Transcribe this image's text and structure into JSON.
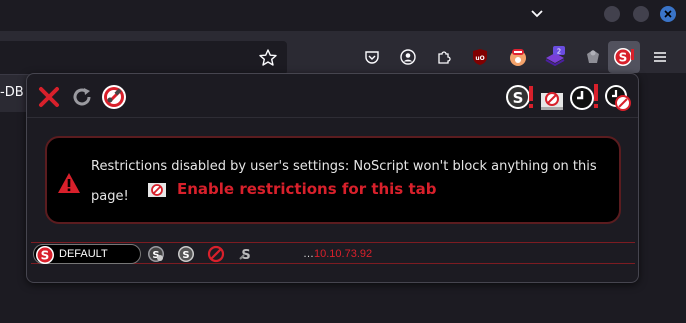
{
  "browser": {
    "tab_partial_label": "-DB",
    "toolbar_icons": [
      "star-icon",
      "pocket-icon",
      "account-icon",
      "extensions-icon",
      "ublock-icon",
      "extension-icon",
      "extension-badge-icon",
      "extension-icon",
      "noscript-icon",
      "menu-icon"
    ],
    "badge_count": "2"
  },
  "popup": {
    "header_icons": [
      "close-icon",
      "reload-icon",
      "options-icon",
      "global-disable-icon",
      "revoke-temp-icon",
      "temp-trust-all-icon",
      "temp-trust-page-icon"
    ],
    "warning": {
      "message": "Restrictions disabled by user's settings: NoScript won't block anything on this page!",
      "enable_label": "Enable restrictions for this tab"
    },
    "preset_row": {
      "preset": "DEFAULT",
      "dots": "…",
      "host": "10.10.73.92"
    }
  },
  "colors": {
    "accent_red": "#d8202b",
    "window_close_blue": "#3a74c8"
  }
}
